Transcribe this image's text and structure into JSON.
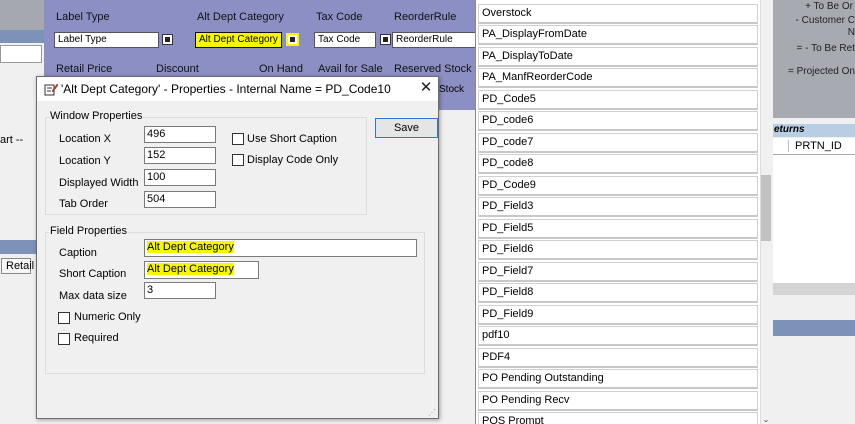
{
  "background_form": {
    "row1_labels": [
      "Label Type",
      "Alt Dept Category",
      "Tax Code",
      "ReorderRule"
    ],
    "row1_values": [
      "Label Type",
      "Alt Dept Category",
      "Tax Code",
      "ReorderRule"
    ],
    "row2_labels": [
      "Retail Price",
      "Discount",
      "On Hand",
      "Avail for Sale",
      "Reserved Stock"
    ],
    "partial_stock_value": "Stock",
    "left_partial_text": "art --",
    "retail_tab": "Retail"
  },
  "right_pane": {
    "notes": [
      "+ To Be Or",
      "- Customer C",
      "N",
      "= - To Be Ret",
      "= Projected On"
    ],
    "returns_header": "eturns",
    "column_header": "PRTN_ID"
  },
  "dropdown_list": {
    "items": [
      "Overstock",
      "PA_DisplayFromDate",
      "PA_DisplayToDate",
      "PA_ManfReorderCode",
      "PD_Code5",
      "PD_code6",
      "PD_code7",
      "PD_code8",
      "PD_Code9",
      "PD_Field3",
      "PD_Field5",
      "PD_Field6",
      "PD_Field7",
      "PD_Field8",
      "PD_Field9",
      "pdf10",
      "PDF4",
      "PO Pending Outstanding",
      "PO Pending Recv",
      "POS Prompt"
    ]
  },
  "dialog": {
    "title": "'Alt Dept Category' - Properties - Internal Name = PD_Code10",
    "close_glyph": "✕",
    "save_label": "Save",
    "window_properties": {
      "caption": "Window Properties",
      "location_x_label": "Location X",
      "location_x": "496",
      "location_y_label": "Location Y",
      "location_y": "152",
      "displayed_width_label": "Displayed Width",
      "displayed_width": "100",
      "tab_order_label": "Tab Order",
      "tab_order": "504",
      "use_short_caption_label": "Use Short Caption",
      "display_code_only_label": "Display Code Only"
    },
    "field_properties": {
      "caption": "Field Properties",
      "caption_label": "Caption",
      "caption_value": "Alt Dept Category",
      "short_caption_label": "Short Caption",
      "short_caption_value": "Alt Dept Category",
      "max_data_size_label": "Max data size",
      "max_data_size": "3",
      "numeric_only_label": "Numeric Only",
      "required_label": "Required"
    }
  },
  "colors": {
    "form_strip": "#8c8fc4",
    "highlight": "#f7f700",
    "focus_border": "#2b78d6"
  },
  "icons": {
    "dialog_icon": "pencil-form-icon",
    "close": "close-icon",
    "picker": "picker-button-icon",
    "scroll_down": "chevron-down-icon"
  }
}
